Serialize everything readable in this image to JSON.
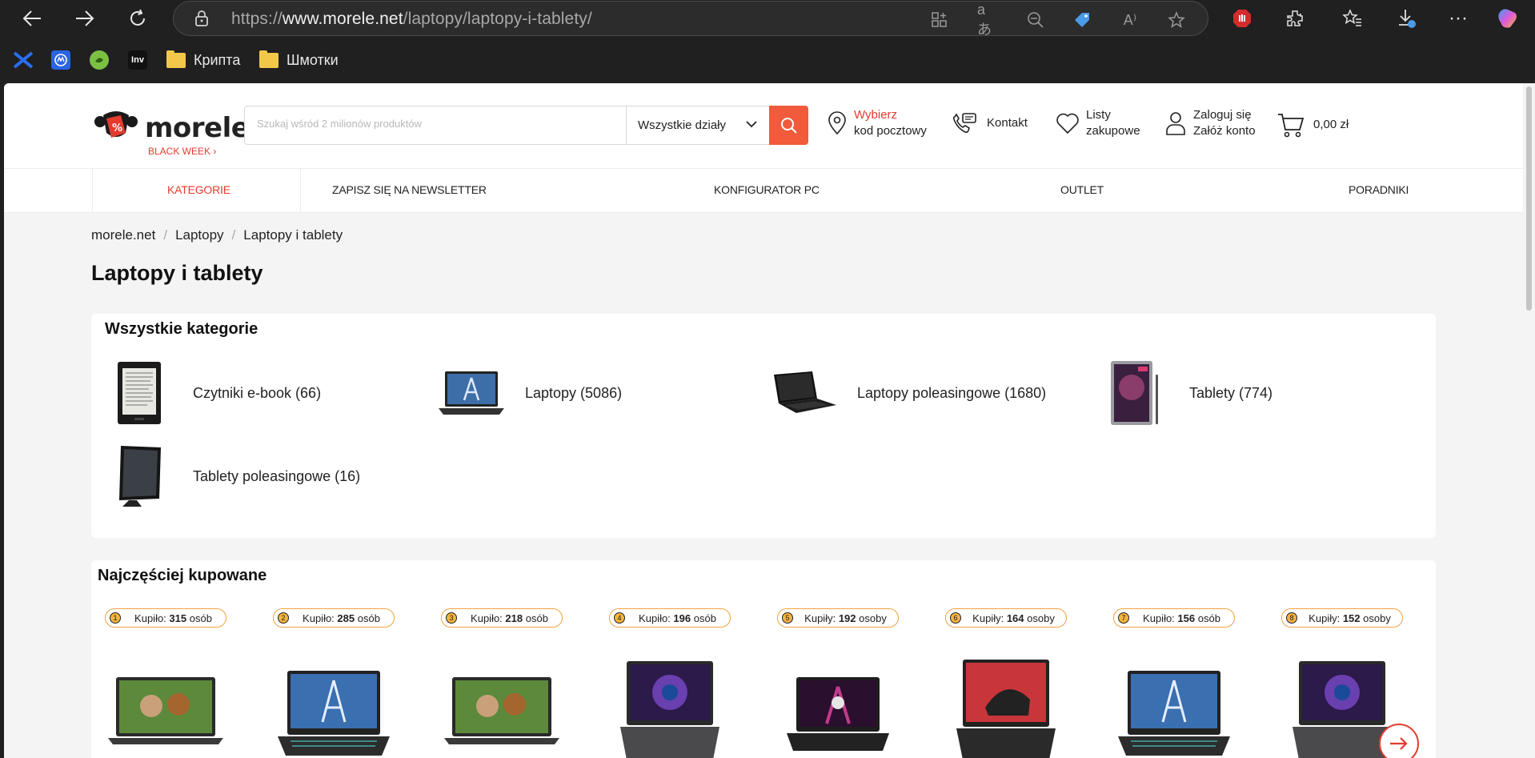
{
  "browser": {
    "url_prefix": "https://",
    "url_domain": "www.morele.net",
    "url_path": "/laptopy/laptopy-i-tablety/",
    "bookmarks": [
      {
        "label": "Крипта"
      },
      {
        "label": "Шмотки"
      }
    ],
    "bookmark_icon_inv": "Inv"
  },
  "header": {
    "logo_text": "morele",
    "logo_sub": "BLACK WEEK",
    "search_placeholder": "Szukaj wśród 2 milionów produktów",
    "department": "Wszystkie działy",
    "postal_line1": "Wybierz",
    "postal_line2": "kod pocztowy",
    "contact": "Kontakt",
    "lists_line1": "Listy",
    "lists_line2": "zakupowe",
    "login_line1": "Zaloguj się",
    "login_line2": "Załóż konto",
    "cart": "0,00 zł"
  },
  "menu": {
    "items": [
      "KATEGORIE",
      "ZAPISZ SIĘ NA NEWSLETTER",
      "KONFIGURATOR PC",
      "OUTLET",
      "PORADNIKI"
    ]
  },
  "breadcrumb": [
    "morele.net",
    "Laptopy",
    "Laptopy i tablety"
  ],
  "page_title": "Laptopy i tablety",
  "categories": {
    "title": "Wszystkie kategorie",
    "items": [
      {
        "label": "Czytniki e-book (66)"
      },
      {
        "label": "Laptopy (5086)"
      },
      {
        "label": "Laptopy poleasingowe (1680)"
      },
      {
        "label": "Tablety (774)"
      },
      {
        "label": "Tablety poleasingowe (16)"
      }
    ]
  },
  "bestsellers": {
    "title": "Najczęściej kupowane",
    "badges": [
      {
        "rank": "1",
        "prefix": "Kupiło: ",
        "count": "315",
        "suffix": " osób"
      },
      {
        "rank": "2",
        "prefix": "Kupiło: ",
        "count": "285",
        "suffix": " osób"
      },
      {
        "rank": "3",
        "prefix": "Kupiło: ",
        "count": "218",
        "suffix": " osób"
      },
      {
        "rank": "4",
        "prefix": "Kupiło: ",
        "count": "196",
        "suffix": " osób"
      },
      {
        "rank": "5",
        "prefix": "Kupiły: ",
        "count": "192",
        "suffix": " osoby"
      },
      {
        "rank": "6",
        "prefix": "Kupiły: ",
        "count": "164",
        "suffix": " osoby"
      },
      {
        "rank": "7",
        "prefix": "Kupiło: ",
        "count": "156",
        "suffix": " osób"
      },
      {
        "rank": "8",
        "prefix": "Kupiły: ",
        "count": "152",
        "suffix": " osoby"
      }
    ]
  },
  "colors": {
    "accent": "#e33b2d",
    "search_button": "#f15a3a",
    "badge_border": "#f4a23c"
  }
}
